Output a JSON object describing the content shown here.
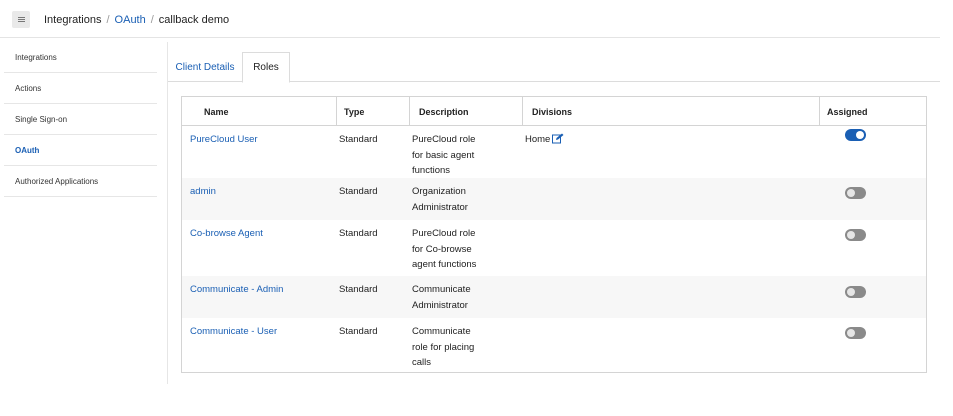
{
  "breadcrumb": {
    "root": "Integrations",
    "sep1": "/",
    "middle": "OAuth",
    "sep2": "/",
    "current": "callback demo"
  },
  "icons": {
    "menu": "menu-icon",
    "edit": "edit-icon"
  },
  "sidebar": {
    "items": [
      {
        "label": "Integrations"
      },
      {
        "label": "Actions"
      },
      {
        "label": "Single Sign-on"
      },
      {
        "label": "OAuth",
        "active": true
      },
      {
        "label": "Authorized Applications"
      }
    ]
  },
  "tabs": {
    "client_details": "Client Details",
    "roles": "Roles",
    "active": "Roles"
  },
  "table": {
    "headers": {
      "name": "Name",
      "type": "Type",
      "description": "Description",
      "divisions": "Divisions",
      "assigned": "Assigned"
    },
    "rows": [
      {
        "name": "PureCloud User",
        "type": "Standard",
        "desc1": "PureCloud role",
        "desc2": "for basic agent",
        "desc3": "functions",
        "division": "Home",
        "assigned": true
      },
      {
        "name": "admin",
        "type": "Standard",
        "desc1": "Organization",
        "desc2": "Administrator",
        "desc3": "",
        "division": "",
        "assigned": false
      },
      {
        "name": "Co-browse Agent",
        "type": "Standard",
        "desc1": "PureCloud role",
        "desc2": "for Co-browse",
        "desc3": "agent functions",
        "division": "",
        "assigned": false
      },
      {
        "name": "Communicate - Admin",
        "type": "Standard",
        "desc1": "Communicate",
        "desc2": "Administrator",
        "desc3": "",
        "division": "",
        "assigned": false
      },
      {
        "name": "Communicate - User",
        "type": "Standard",
        "desc1": "Communicate",
        "desc2": "role for placing",
        "desc3": "calls",
        "division": "",
        "assigned": false
      }
    ]
  },
  "colors": {
    "link": "#1a5fb4",
    "toggle_on": "#1a5fb4",
    "toggle_off": "#8a8a8a"
  }
}
